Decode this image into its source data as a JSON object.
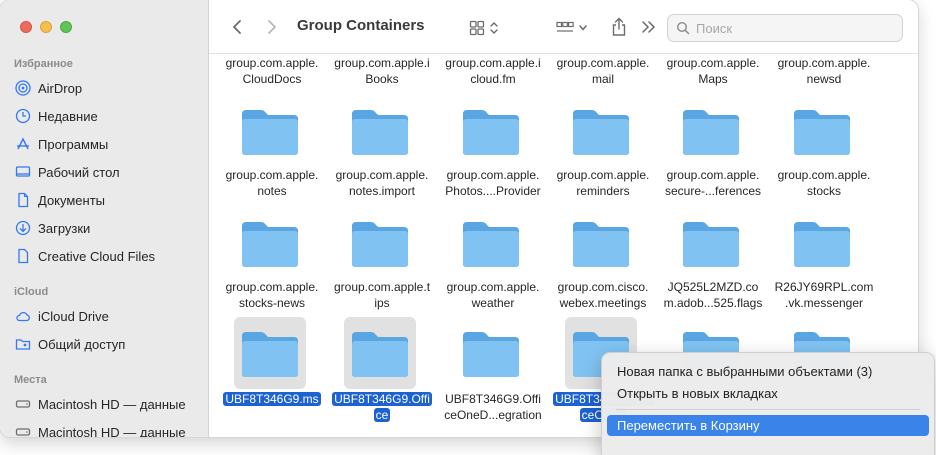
{
  "window": {
    "title": "Group Containers"
  },
  "sidebar": {
    "sections": [
      {
        "label": "Избранное",
        "items": [
          {
            "label": "AirDrop",
            "icon": "airdrop-icon"
          },
          {
            "label": "Недавние",
            "icon": "clock-icon"
          },
          {
            "label": "Программы",
            "icon": "applications-icon"
          },
          {
            "label": "Рабочий стол",
            "icon": "desktop-icon"
          },
          {
            "label": "Документы",
            "icon": "document-icon"
          },
          {
            "label": "Загрузки",
            "icon": "download-icon"
          },
          {
            "label": "Creative Cloud Files",
            "icon": "file-icon"
          }
        ]
      },
      {
        "label": "iCloud",
        "items": [
          {
            "label": "iCloud Drive",
            "icon": "cloud-icon"
          },
          {
            "label": "Общий доступ",
            "icon": "shared-folder-icon"
          }
        ]
      },
      {
        "label": "Места",
        "items": [
          {
            "label": "Macintosh HD — данные",
            "icon": "disk-icon"
          },
          {
            "label": "Macintosh HD — данные",
            "icon": "disk-icon"
          }
        ]
      }
    ]
  },
  "search": {
    "placeholder": "Поиск"
  },
  "accent_color": "#1c62d3",
  "folder_color": "#7cc1f0",
  "files": {
    "row0": [
      {
        "l1": "group.com.apple.",
        "l2": "CloudDocs"
      },
      {
        "l1": "group.com.apple.i",
        "l2": "Books"
      },
      {
        "l1": "group.com.apple.i",
        "l2": "cloud.fm"
      },
      {
        "l1": "group.com.apple.",
        "l2": "mail"
      },
      {
        "l1": "group.com.apple.",
        "l2": "Maps"
      },
      {
        "l1": "group.com.apple.",
        "l2": "newsd"
      }
    ],
    "row1": [
      {
        "l1": "group.com.apple.",
        "l2": "notes"
      },
      {
        "l1": "group.com.apple.",
        "l2": "notes.import"
      },
      {
        "l1": "group.com.apple.",
        "l2": "Photos....Provider"
      },
      {
        "l1": "group.com.apple.",
        "l2": "reminders"
      },
      {
        "l1": "group.com.apple.",
        "l2": "secure-...ferences"
      },
      {
        "l1": "group.com.apple.",
        "l2": "stocks"
      }
    ],
    "row2": [
      {
        "l1": "group.com.apple.",
        "l2": "stocks-news"
      },
      {
        "l1": "group.com.apple.t",
        "l2": "ips"
      },
      {
        "l1": "group.com.apple.",
        "l2": "weather"
      },
      {
        "l1": "group.com.cisco.",
        "l2": "webex.meetings"
      },
      {
        "l1": "JQ525L2MZD.co",
        "l2": "m.adob...525.flags"
      },
      {
        "l1": "R26JY69RPL.com",
        "l2": ".vk.messenger"
      }
    ],
    "row3": [
      {
        "l1": "UBF8T346G9.ms",
        "l2": "",
        "selected": true
      },
      {
        "l1": "UBF8T346G9.Offi",
        "l2": "ce",
        "selected": true
      },
      {
        "l1": "UBF8T346G9.Offi",
        "l2": "ceOneD...egration",
        "selected": false
      },
      {
        "l1": "UBF8T346G9.Offi",
        "l2": "ceOsfW",
        "selected": true
      }
    ]
  },
  "context_menu": {
    "items": [
      "Новая папка с выбранными объектами (3)",
      "Открыть в новых вкладках",
      "Переместить в Корзину"
    ]
  }
}
